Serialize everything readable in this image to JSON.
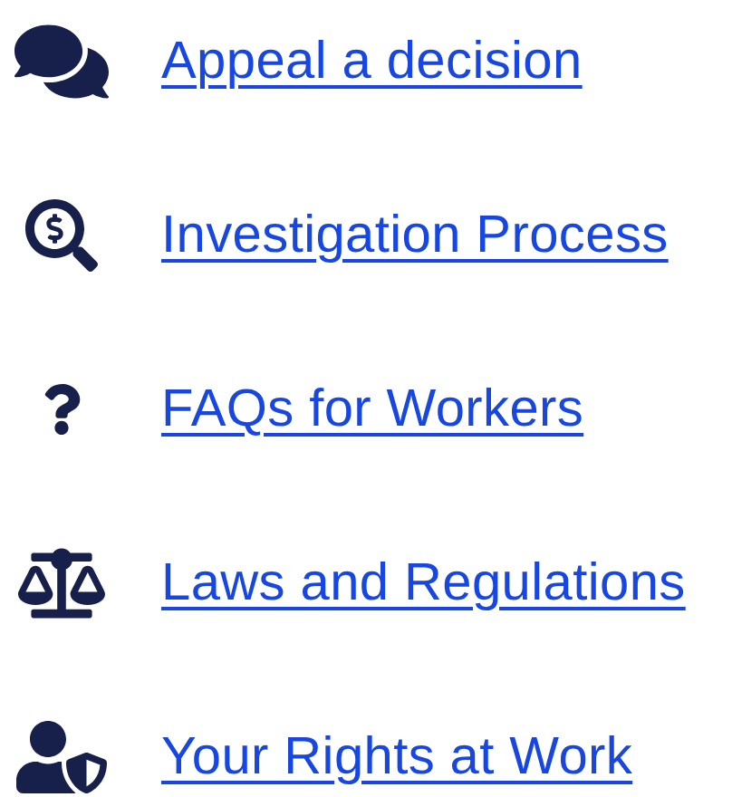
{
  "links": [
    {
      "kind": "comments",
      "label": "Appeal a decision"
    },
    {
      "kind": "search-dollar",
      "label": "Investigation Process"
    },
    {
      "kind": "question",
      "label": "FAQs for Workers"
    },
    {
      "kind": "scale",
      "label": "Laws and Regulations"
    },
    {
      "kind": "user-shield",
      "label": "Your Rights at Work"
    }
  ]
}
